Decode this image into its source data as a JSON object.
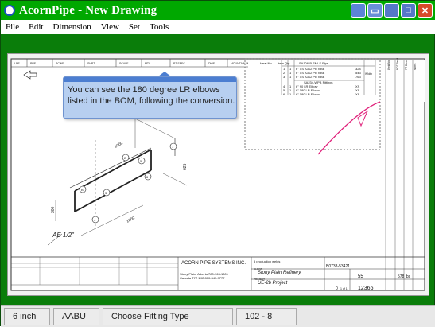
{
  "window": {
    "title": "AcornPipe - New Drawing",
    "icon": "acornpipe-icon",
    "buttons": [
      "help-icon",
      "restore-small-icon",
      "minimize-icon",
      "maximize-icon",
      "close-icon"
    ]
  },
  "menu": [
    "File",
    "Edit",
    "Dimension",
    "View",
    "Set",
    "Tools"
  ],
  "bom": {
    "headers": [
      "Heat No.",
      "Item",
      "Qty",
      "SA106-B SMLS Pipe"
    ],
    "pipe_rows": [
      [
        "1",
        "1",
        "6\" XS A312 PE x BE",
        "324"
      ],
      [
        "2",
        "1",
        "6\" XS A312 PE x BE",
        "543"
      ],
      [
        "3",
        "1",
        "6\" XS A312 PE x BE",
        "763"
      ]
    ],
    "fitting_header": "SA234-WPB Fittings",
    "fitting_rows": [
      [
        "4",
        "1",
        "6\" 90 LR Elbow",
        "XS"
      ],
      [
        "5",
        "1",
        "6\" 180 LR Elbow",
        "XS"
      ],
      [
        "6",
        "1",
        "6\" 180 LR Elbow",
        "XS"
      ]
    ],
    "side_cols": [
      "Weld No.",
      "Weld#",
      "NDT Reqd",
      "PT Done",
      "Notes"
    ],
    "width_label": "Width"
  },
  "callout": {
    "text": "You can see the 180 degree LR elbows listed in the BOM, following the conversion."
  },
  "iso": {
    "dims": [
      "1000\n(40\")",
      "625",
      "300",
      "1000\n(40\")"
    ],
    "tags": [
      "1",
      "2",
      "3",
      "4",
      "5",
      "6",
      "B",
      "C"
    ],
    "north": "N",
    "elevation_note": "AE 1/2\""
  },
  "titleblock": {
    "company": "ACORN PIPE SYSTEMS INC.",
    "address": "Stony Plain, Alberta  780-963-1301\nCanada T7Z 1X2     800-343-9777",
    "client_label": "CLIENT",
    "client": "Stony Plain Refinery",
    "project_label": "PROJECT",
    "project": "UE-2b Project",
    "drawing_label": "DWG No.",
    "drawing": "12366",
    "job": "55",
    "job_label": "JOB No.",
    "spool": "5",
    "spool_label": "SPOOL",
    "sheet": "1 of 1",
    "rev": "0",
    "weld_label": "5 production welds",
    "po": "B0738-53421",
    "total": "578 lbs",
    "date": "DATE"
  },
  "status": [
    "6 inch",
    "AABU",
    "Choose Fitting Type",
    "102 - 8"
  ]
}
